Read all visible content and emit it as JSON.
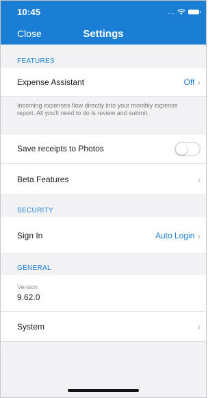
{
  "status": {
    "time": "10:45",
    "signal": "....",
    "wifi_icon": "wifi-icon",
    "battery_icon": "battery-icon"
  },
  "nav": {
    "close_label": "Close",
    "title": "Settings"
  },
  "features": {
    "header": "FEATURES",
    "expense_assistant": {
      "label": "Expense Assistant",
      "value": "Off"
    },
    "expense_info": "Incoming expenses flow directly into your monthly expense report. All you'll need to do is review and submit.",
    "save_receipts": {
      "label": "Save receipts to Photos",
      "enabled": false
    },
    "beta": {
      "label": "Beta Features"
    }
  },
  "security": {
    "header": "SECURITY",
    "sign_in": {
      "label": "Sign In",
      "value": "Auto Login"
    }
  },
  "general": {
    "header": "GENERAL",
    "version": {
      "caption": "Version",
      "value": "9.62.0"
    },
    "system": {
      "label": "System"
    }
  },
  "colors": {
    "accent": "#1a7fd4",
    "background": "#f2f2f4",
    "row": "#ffffff"
  }
}
